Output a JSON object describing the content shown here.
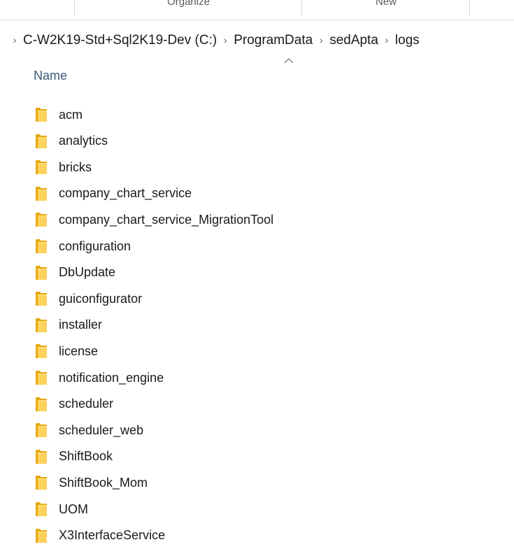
{
  "ribbon": {
    "groups": [
      {
        "label": ""
      },
      {
        "label": "Organize"
      },
      {
        "label": "New"
      },
      {
        "label": ""
      }
    ]
  },
  "breadcrumb": {
    "items": [
      {
        "label": "C-W2K19-Std+Sql2K19-Dev (C:)"
      },
      {
        "label": "ProgramData"
      },
      {
        "label": "sedApta"
      },
      {
        "label": "logs"
      }
    ],
    "separator": "›"
  },
  "list": {
    "column_header": "Name",
    "sort_direction": "ascending",
    "items": [
      {
        "name": "acm",
        "icon": "folder-icon"
      },
      {
        "name": "analytics",
        "icon": "folder-icon"
      },
      {
        "name": "bricks",
        "icon": "folder-icon"
      },
      {
        "name": "company_chart_service",
        "icon": "folder-icon"
      },
      {
        "name": "company_chart_service_MigrationTool",
        "icon": "folder-icon"
      },
      {
        "name": "configuration",
        "icon": "folder-icon"
      },
      {
        "name": "DbUpdate",
        "icon": "folder-icon"
      },
      {
        "name": "guiconfigurator",
        "icon": "folder-icon"
      },
      {
        "name": "installer",
        "icon": "folder-icon"
      },
      {
        "name": "license",
        "icon": "folder-icon"
      },
      {
        "name": "notification_engine",
        "icon": "folder-icon"
      },
      {
        "name": "scheduler",
        "icon": "folder-icon"
      },
      {
        "name": "scheduler_web",
        "icon": "folder-icon"
      },
      {
        "name": "ShiftBook",
        "icon": "folder-icon"
      },
      {
        "name": "ShiftBook_Mom",
        "icon": "folder-icon"
      },
      {
        "name": "UOM",
        "icon": "folder-icon"
      },
      {
        "name": "X3InterfaceService",
        "icon": "folder-icon"
      }
    ]
  },
  "colors": {
    "folder_back": "#e8a913",
    "folder_front": "#fcd25c",
    "header_text": "#3b5a7a"
  }
}
